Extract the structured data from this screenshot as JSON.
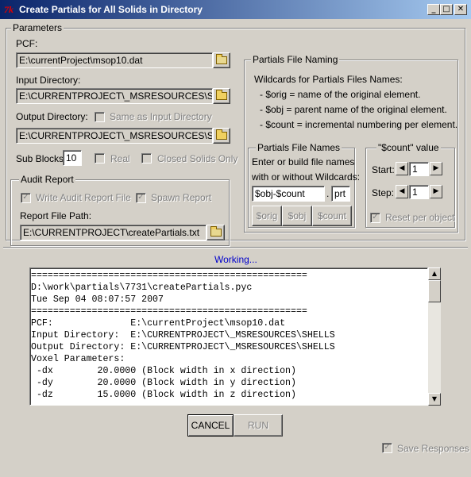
{
  "window": {
    "title": "Create Partials for All Solids in Directory",
    "minimize_glyph": "_",
    "maximize_glyph": "□",
    "close_glyph": "✕",
    "icon_name": "tk-icon",
    "icon_text": "7k"
  },
  "parameters": {
    "group_label": "Parameters",
    "pcf_label": "PCF:",
    "pcf_value": "E:\\currentProject\\msop10.dat",
    "input_dir_label": "Input Directory:",
    "input_dir_value": "E:\\CURRENTPROJECT\\_MSRESOURCES\\SHELLS",
    "output_dir_label": "Output Directory:",
    "same_as_input_label": "Same as Input Directory",
    "same_as_input_checked": false,
    "output_dir_value": "E:\\CURRENTPROJECT\\_MSRESOURCES\\SHELLS",
    "sub_blocks_label": "Sub Blocks:",
    "sub_blocks_value": "10",
    "real_label": "Real",
    "real_checked": false,
    "closed_solids_label": "Closed Solids Only",
    "closed_solids_checked": false
  },
  "audit": {
    "group_label": "Audit Report",
    "write_audit_label": "Write Audit Report File",
    "write_audit_checked": true,
    "spawn_report_label": "Spawn Report",
    "spawn_report_checked": true,
    "report_path_label": "Report File Path:",
    "report_path_value": "E:\\CURRENTPROJECT\\createPartials.txt"
  },
  "naming": {
    "group_label": "Partials File Naming",
    "wildcards_title": "Wildcards for Partials Files Names:",
    "wildcard_orig": "- $orig  = name of the original element.",
    "wildcard_obj": "- $obj   = parent name of the original element.",
    "wildcard_count": "- $count = incremental numbering per element.",
    "file_names": {
      "group_label": "Partials File Names",
      "hint_line1": "Enter or build file names",
      "hint_line2": "with or without Wildcards:",
      "name_value": "$obj-$count",
      "dot": ".",
      "ext_value": "prt",
      "btn_orig": "$orig",
      "btn_obj": "$obj",
      "btn_count": "$count"
    },
    "count": {
      "group_label": "\"$count\" value",
      "start_label": "Start:",
      "start_value": "1",
      "step_label": "Step:",
      "step_value": "1",
      "reset_label": "Reset per object",
      "reset_checked": true,
      "left_arrow": "◀",
      "right_arrow": "▶"
    }
  },
  "status": "Working...",
  "log_text": "==================================================\nD:\\work\\partials\\7731\\createPartials.pyc\nTue Sep 04 08:07:57 2007\n==================================================\nPCF:              E:\\currentProject\\msop10.dat\nInput Directory:  E:\\CURRENTPROJECT\\_MSRESOURCES\\SHELLS\nOutput Directory: E:\\CURRENTPROJECT\\_MSRESOURCES\\SHELLS\nVoxel Parameters:\n -dx        20.0000 (Block width in x direction)\n -dy        20.0000 (Block width in y direction)\n -dz        15.0000 (Block width in z direction)",
  "buttons": {
    "cancel": "CANCEL",
    "run": "RUN"
  },
  "save_responses_label": "Save Responses",
  "save_responses_checked": true,
  "scroll": {
    "up_arrow": "▲",
    "down_arrow": "▼"
  }
}
